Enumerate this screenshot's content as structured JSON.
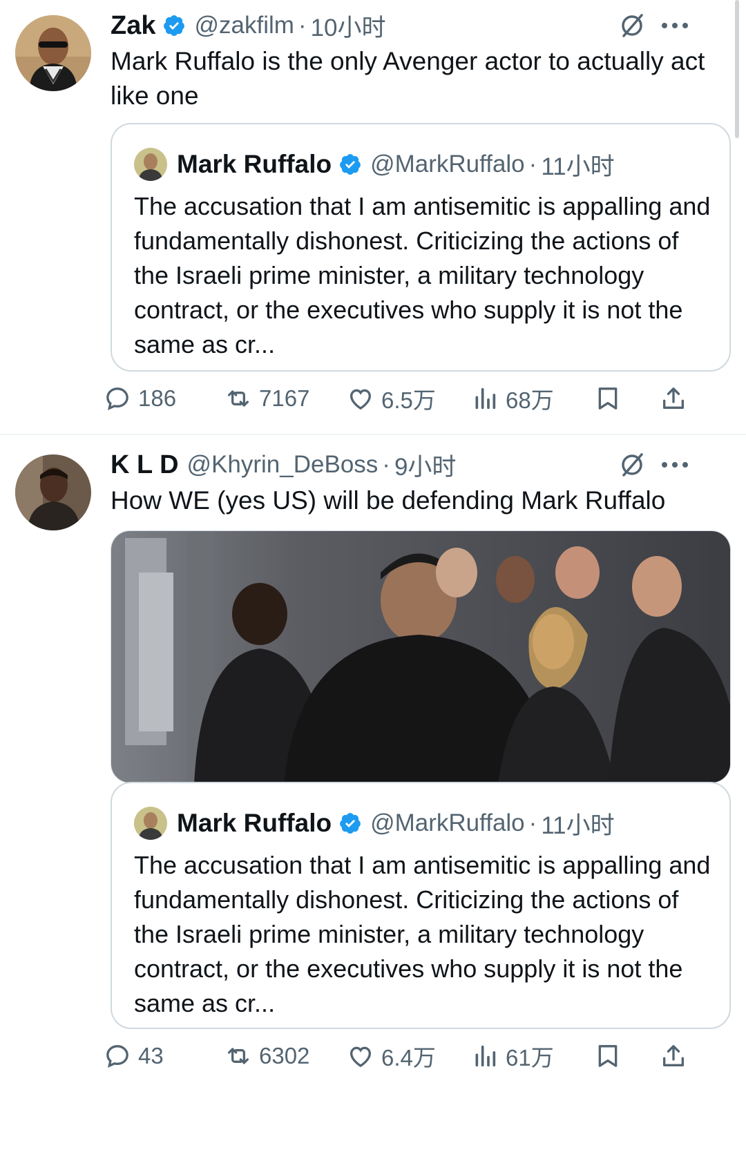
{
  "tweets": [
    {
      "name": "Zak",
      "handle": "@zakfilm",
      "time": "10小时",
      "text": "Mark Ruffalo is the only Avenger actor to actually act like one",
      "quote": {
        "name": "Mark Ruffalo",
        "handle": "@MarkRuffalo",
        "time": "11小时",
        "text": "The accusation that I am antisemitic is appalling and fundamentally dishonest. Criticizing the actions of the Israeli prime minister, a military technology contract, or the executives who supply it is not the same as cr..."
      },
      "stats": {
        "replies": "186",
        "reposts": "7167",
        "likes": "6.5万",
        "views": "68万"
      }
    },
    {
      "name": "K L D",
      "handle": "@Khyrin_DeBoss",
      "time": "9小时",
      "text": "How WE (yes US) will be defending Mark Ruffalo",
      "quote": {
        "name": "Mark Ruffalo",
        "handle": "@MarkRuffalo",
        "time": "11小时",
        "text": "The accusation that I am antisemitic is appalling and fundamentally dishonest. Criticizing the actions of the Israeli prime minister, a military technology contract, or the executives who supply it is not the same as cr..."
      },
      "stats": {
        "replies": "43",
        "reposts": "6302",
        "likes": "6.4万",
        "views": "61万"
      }
    }
  ],
  "separator": "·",
  "colors": {
    "verified": "#1d9bf0",
    "text": "#0f1419",
    "muted": "#536471",
    "border": "#cfd9de"
  },
  "icons": [
    "verified-badge-icon",
    "grok-icon",
    "more-icon",
    "reply-icon",
    "repost-icon",
    "like-icon",
    "views-icon",
    "bookmark-icon",
    "share-icon"
  ]
}
